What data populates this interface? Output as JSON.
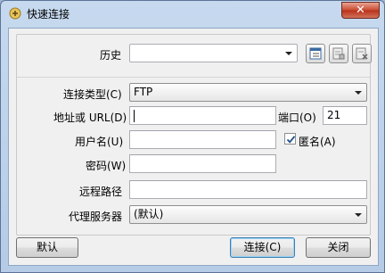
{
  "window": {
    "title": "快速连接",
    "close_glyph": "✕"
  },
  "history": {
    "label": "历史",
    "value": ""
  },
  "connection_type": {
    "label": "连接类型(C)",
    "value": "FTP"
  },
  "address": {
    "label": "地址或 URL(D)",
    "value": ""
  },
  "port": {
    "label": "端口(O)",
    "value": "21"
  },
  "username": {
    "label": "用户名(U)",
    "value": ""
  },
  "anonymous": {
    "label": "匿名(A)",
    "checked": true
  },
  "password": {
    "label": "密码(W)",
    "value": ""
  },
  "remote_path": {
    "label": "远程路径",
    "value": ""
  },
  "proxy": {
    "label": "代理服务器",
    "value": "(默认)"
  },
  "buttons": {
    "defaults": "默认",
    "connect": "连接(C)",
    "close": "关闭"
  },
  "colors": {
    "accent": "#3c7fb1",
    "close": "#c9492f"
  }
}
